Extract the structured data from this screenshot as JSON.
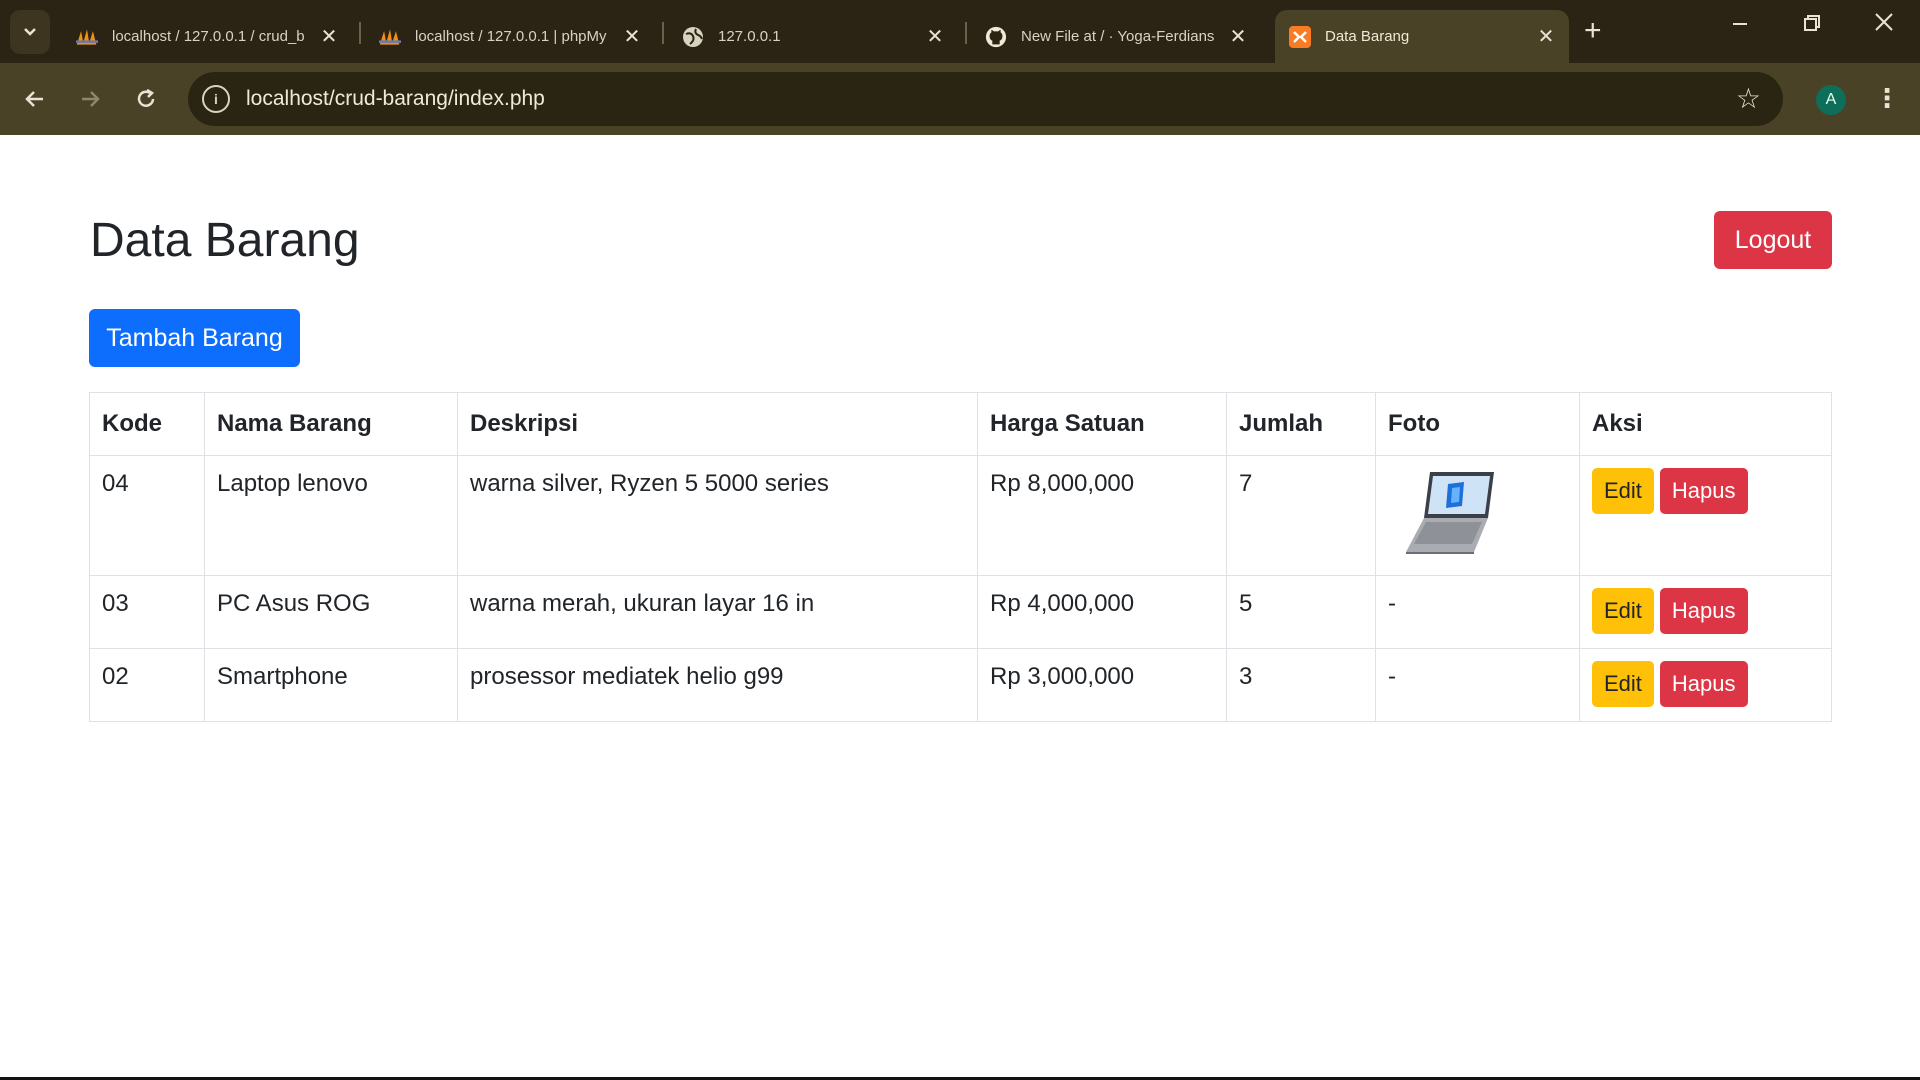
{
  "browser": {
    "tabs": [
      {
        "title": "localhost / 127.0.0.1 / crud_b",
        "icon": "phpmyadmin-icon"
      },
      {
        "title": "localhost / 127.0.0.1 | phpMy",
        "icon": "phpmyadmin-icon"
      },
      {
        "title": "127.0.0.1",
        "icon": "globe-icon"
      },
      {
        "title": "New File at / · Yoga-Ferdians",
        "icon": "github-icon"
      },
      {
        "title": "Data Barang",
        "icon": "xampp-icon"
      }
    ],
    "url": "localhost/crud-barang/index.php",
    "profile_initial": "A"
  },
  "page": {
    "title": "Data Barang",
    "logout_label": "Logout",
    "add_label": "Tambah Barang"
  },
  "table": {
    "headers": [
      "Kode",
      "Nama Barang",
      "Deskripsi",
      "Harga Satuan",
      "Jumlah",
      "Foto",
      "Aksi"
    ],
    "rows": [
      {
        "kode": "04",
        "nama": "Laptop lenovo",
        "deskripsi": "warna silver, Ryzen 5 5000 series",
        "harga": "Rp 8,000,000",
        "jumlah": "7",
        "foto": "",
        "edit": "Edit",
        "hapus": "Hapus"
      },
      {
        "kode": "03",
        "nama": "PC Asus ROG",
        "deskripsi": "warna merah, ukuran layar 16 in",
        "harga": "Rp 4,000,000",
        "jumlah": "5",
        "foto": "-",
        "edit": "Edit",
        "hapus": "Hapus"
      },
      {
        "kode": "02",
        "nama": "Smartphone",
        "deskripsi": "prosessor mediatek helio g99",
        "harga": "Rp 3,000,000",
        "jumlah": "3",
        "foto": "-",
        "edit": "Edit",
        "hapus": "Hapus"
      }
    ]
  },
  "colors": {
    "primary": "#0d6efd",
    "danger": "#dc3545",
    "warning": "#ffc107"
  }
}
